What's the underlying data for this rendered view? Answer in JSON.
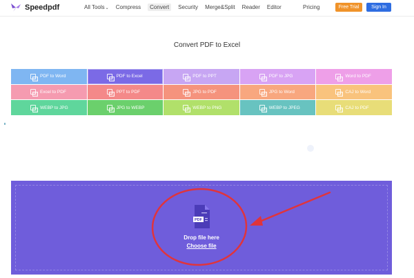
{
  "brand": {
    "name": "Speedpdf"
  },
  "nav": {
    "links": [
      {
        "label": "All Tools",
        "has_dropdown": true
      },
      {
        "label": "Compress"
      },
      {
        "label": "Convert",
        "active": true
      },
      {
        "label": "Security"
      },
      {
        "label": "Merge&Split"
      },
      {
        "label": "Reader"
      },
      {
        "label": "Editor"
      }
    ],
    "pricing": "Pricing",
    "free_trial": "Free Trial",
    "sign_in": "Sign In"
  },
  "page": {
    "title": "Convert PDF to Excel"
  },
  "tools": [
    {
      "label": "PDF to Word",
      "color": "#7fb6f2"
    },
    {
      "label": "PDF to Excel",
      "color": "#7b6ae6",
      "selected": true
    },
    {
      "label": "PDF to PPT",
      "color": "#c7a6f3"
    },
    {
      "label": "PDF to JPG",
      "color": "#d8a3f4"
    },
    {
      "label": "Word to PDF",
      "color": "#ee9fe8"
    },
    {
      "label": "Excel to PDF",
      "color": "#f59bb0"
    },
    {
      "label": "PPT to PDF",
      "color": "#f48989"
    },
    {
      "label": "JPG to PDF",
      "color": "#f5937d"
    },
    {
      "label": "JPG to Word",
      "color": "#f8a77f"
    },
    {
      "label": "CAJ to Word",
      "color": "#f9c37d"
    },
    {
      "label": "WEBP to JPG",
      "color": "#5fd69c"
    },
    {
      "label": "JPG to WEBP",
      "color": "#6bd06c"
    },
    {
      "label": "WEBP to PNG",
      "color": "#b1e06a"
    },
    {
      "label": "WEBP to JPEG",
      "color": "#68c3c0"
    },
    {
      "label": "CAJ to PDF",
      "color": "#e8dd78"
    }
  ],
  "upload": {
    "drop_label": "Drop file here",
    "choose_label": "Choose file",
    "file_icon_label": "PDF",
    "bg_color": "#6f5ddb"
  },
  "annotation_color": "#e0343c"
}
